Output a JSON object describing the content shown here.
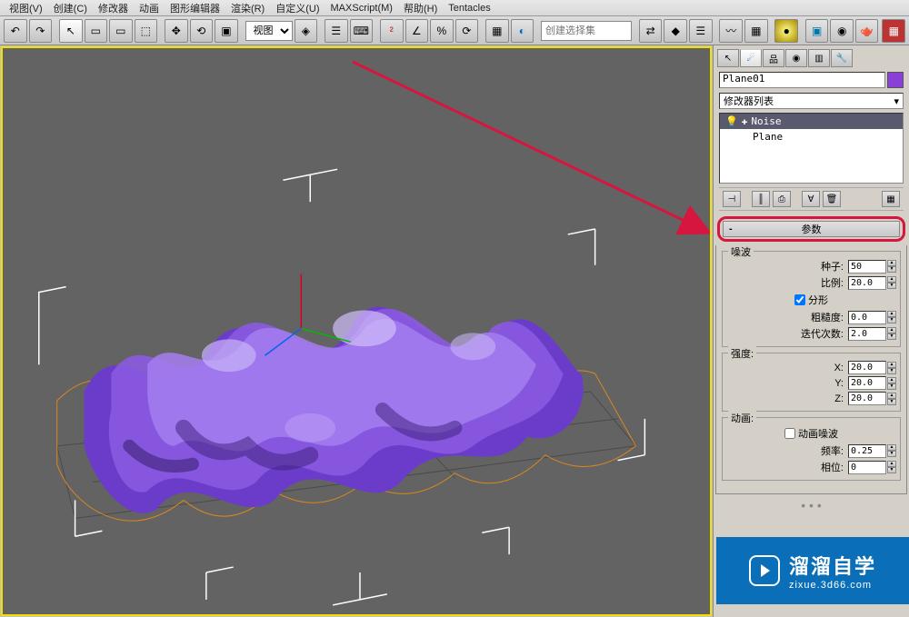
{
  "menu": {
    "items": [
      "视图(V)",
      "创建(C)",
      "修改器",
      "动画",
      "图形编辑器",
      "渲染(R)",
      "自定义(U)",
      "MAXScript(M)",
      "帮助(H)",
      "Tentacles"
    ]
  },
  "toolbar": {
    "viewport_dropdown": "视图",
    "selection_set_placeholder": "创建选择集"
  },
  "panel": {
    "object_name": "Plane01",
    "modifier_list_label": "修改器列表",
    "stack": {
      "noise": "Noise",
      "plane": "Plane"
    },
    "rollout_params": "参数",
    "noise_group": "噪波",
    "seed_label": "种子:",
    "seed_value": "50",
    "scale_label": "比例:",
    "scale_value": "20.0",
    "fractal_label": "分形",
    "roughness_label": "粗糙度:",
    "roughness_value": "0.0",
    "iterations_label": "迭代次数:",
    "iterations_value": "2.0",
    "strength_group": "强度:",
    "x_label": "X:",
    "x_value": "20.0",
    "y_label": "Y:",
    "y_value": "20.0",
    "z_label": "Z:",
    "z_value": "20.0",
    "anim_group": "动画:",
    "anim_noise_label": "动画噪波",
    "freq_label": "频率:",
    "freq_value": "0.25",
    "phase_label": "相位:",
    "phase_value": "0"
  },
  "watermark": {
    "title": "溜溜自学",
    "url": "zixue.3d66.com"
  }
}
